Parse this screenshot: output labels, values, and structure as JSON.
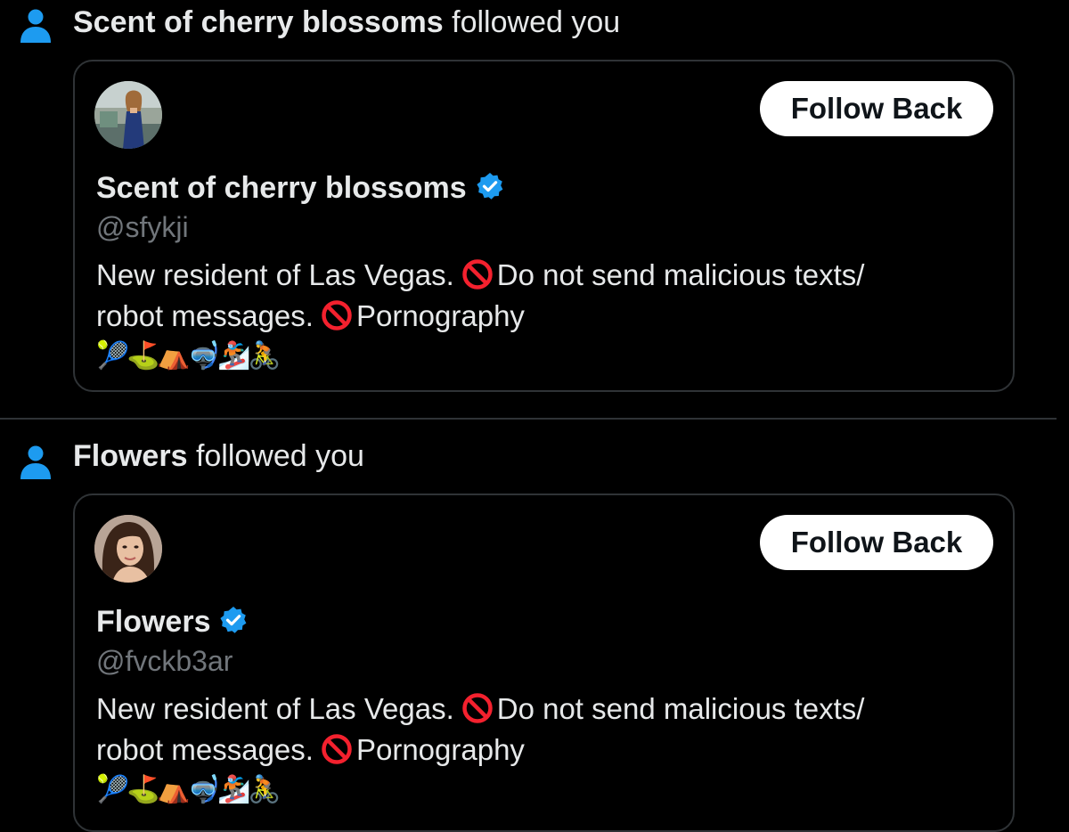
{
  "notifications": [
    {
      "actor": "Scent of cherry blossoms",
      "action": "followed you",
      "icon": "person-icon",
      "card": {
        "follow_button": "Follow Back",
        "display_name": "Scent of cherry blossoms",
        "verified": true,
        "handle": "@sfykji",
        "bio_line1_pre": "New resident of Las Vegas.",
        "bio_line1_post": "Do not send malicious texts/",
        "bio_line2_pre": "robot messages.",
        "bio_line2_post": "Pornography",
        "emojis": [
          "🎾",
          "⛳",
          "⛺",
          "🤿",
          "🏂",
          "🚴"
        ]
      }
    },
    {
      "actor": "Flowers",
      "action": "followed you",
      "icon": "person-icon",
      "card": {
        "follow_button": "Follow Back",
        "display_name": "Flowers",
        "verified": true,
        "handle": "@fvckb3ar",
        "bio_line1_pre": "New resident of Las Vegas.",
        "bio_line1_post": "Do not send malicious texts/",
        "bio_line2_pre": "robot messages.",
        "bio_line2_post": "Pornography",
        "emojis": [
          "🎾",
          "⛳",
          "⛺",
          "🤿",
          "🏂",
          "🚴"
        ]
      }
    }
  ],
  "colors": {
    "background": "#000000",
    "text": "#e7e9ea",
    "secondary_text": "#71767b",
    "accent": "#1d9bf0",
    "border": "#2f3336",
    "button_bg": "#ffffff",
    "prohibited": "#f4212e"
  }
}
